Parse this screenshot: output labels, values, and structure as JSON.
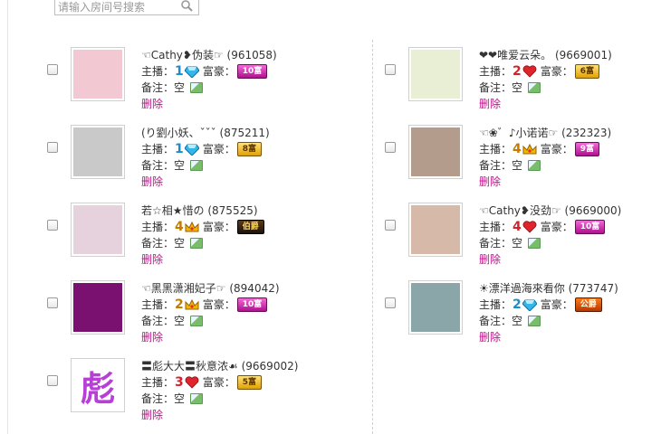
{
  "search": {
    "placeholder": "请输入房间号搜索",
    "icon": "search-icon"
  },
  "labels": {
    "anchor": "主播：",
    "rich": "富豪：",
    "note": "备注：",
    "note_value": "空",
    "delete": "删除"
  },
  "cards": [
    {
      "name": "☜Cathy❥伪装☞",
      "id": "(961058)",
      "anchor_level": "1",
      "anchor_icon": "diamond-icon",
      "rich_badge": "10富",
      "badge_color": "pink",
      "avatar": "#f2c9d3"
    },
    {
      "name": "❤❤唯爱云朵。",
      "id": "(9669001)",
      "anchor_level": "2",
      "anchor_icon": "heart-icon",
      "rich_badge": "6富",
      "badge_color": "yellow",
      "avatar": "#e9efd5"
    },
    {
      "name": "(り劉小妖、ˇˇˇ",
      "id": "(875211)",
      "anchor_level": "1",
      "anchor_icon": "diamond-icon",
      "rich_badge": "8富",
      "badge_color": "yellow",
      "avatar": "#c9c9c9"
    },
    {
      "name": "☜❀゛♪小诺诺☞",
      "id": "(232323)",
      "anchor_level": "4",
      "anchor_icon": "crown-icon",
      "rich_badge": "9富",
      "badge_color": "pink",
      "avatar": "#b49c8c"
    },
    {
      "name": "若☆相★惜の",
      "id": "(875525)",
      "anchor_level": "4",
      "anchor_icon": "crown-icon",
      "rich_badge": "伯爵",
      "badge_color": "dark",
      "avatar": "#e6d2dc"
    },
    {
      "name": "☜Cathy❥没劲☞",
      "id": "(9669000)",
      "anchor_level": "4",
      "anchor_icon": "heart-icon",
      "rich_badge": "10富",
      "badge_color": "pink",
      "avatar": "#d6b9a8"
    },
    {
      "name": "☜黑黑潇湘妃子☞",
      "id": "(894042)",
      "anchor_level": "2",
      "anchor_icon": "crown-icon",
      "rich_badge": "10富",
      "badge_color": "pink",
      "avatar": "#7a1070"
    },
    {
      "name": "☀漂洋過海來看你",
      "id": "(773747)",
      "anchor_level": "2",
      "anchor_icon": "diamond-icon",
      "rich_badge": "公爵",
      "badge_color": "orange",
      "avatar": "#8aa6a8"
    },
    {
      "name": "〓彪大大〓秋意浓☙",
      "id": "(9669002)",
      "anchor_level": "3",
      "anchor_icon": "heart-icon",
      "rich_badge": "5富",
      "badge_color": "yellow",
      "avatar": "#ffffff",
      "avatar_text": "彪"
    }
  ],
  "colors": {
    "delete_link": "#c0108a",
    "divider": "#cfcfcf"
  }
}
